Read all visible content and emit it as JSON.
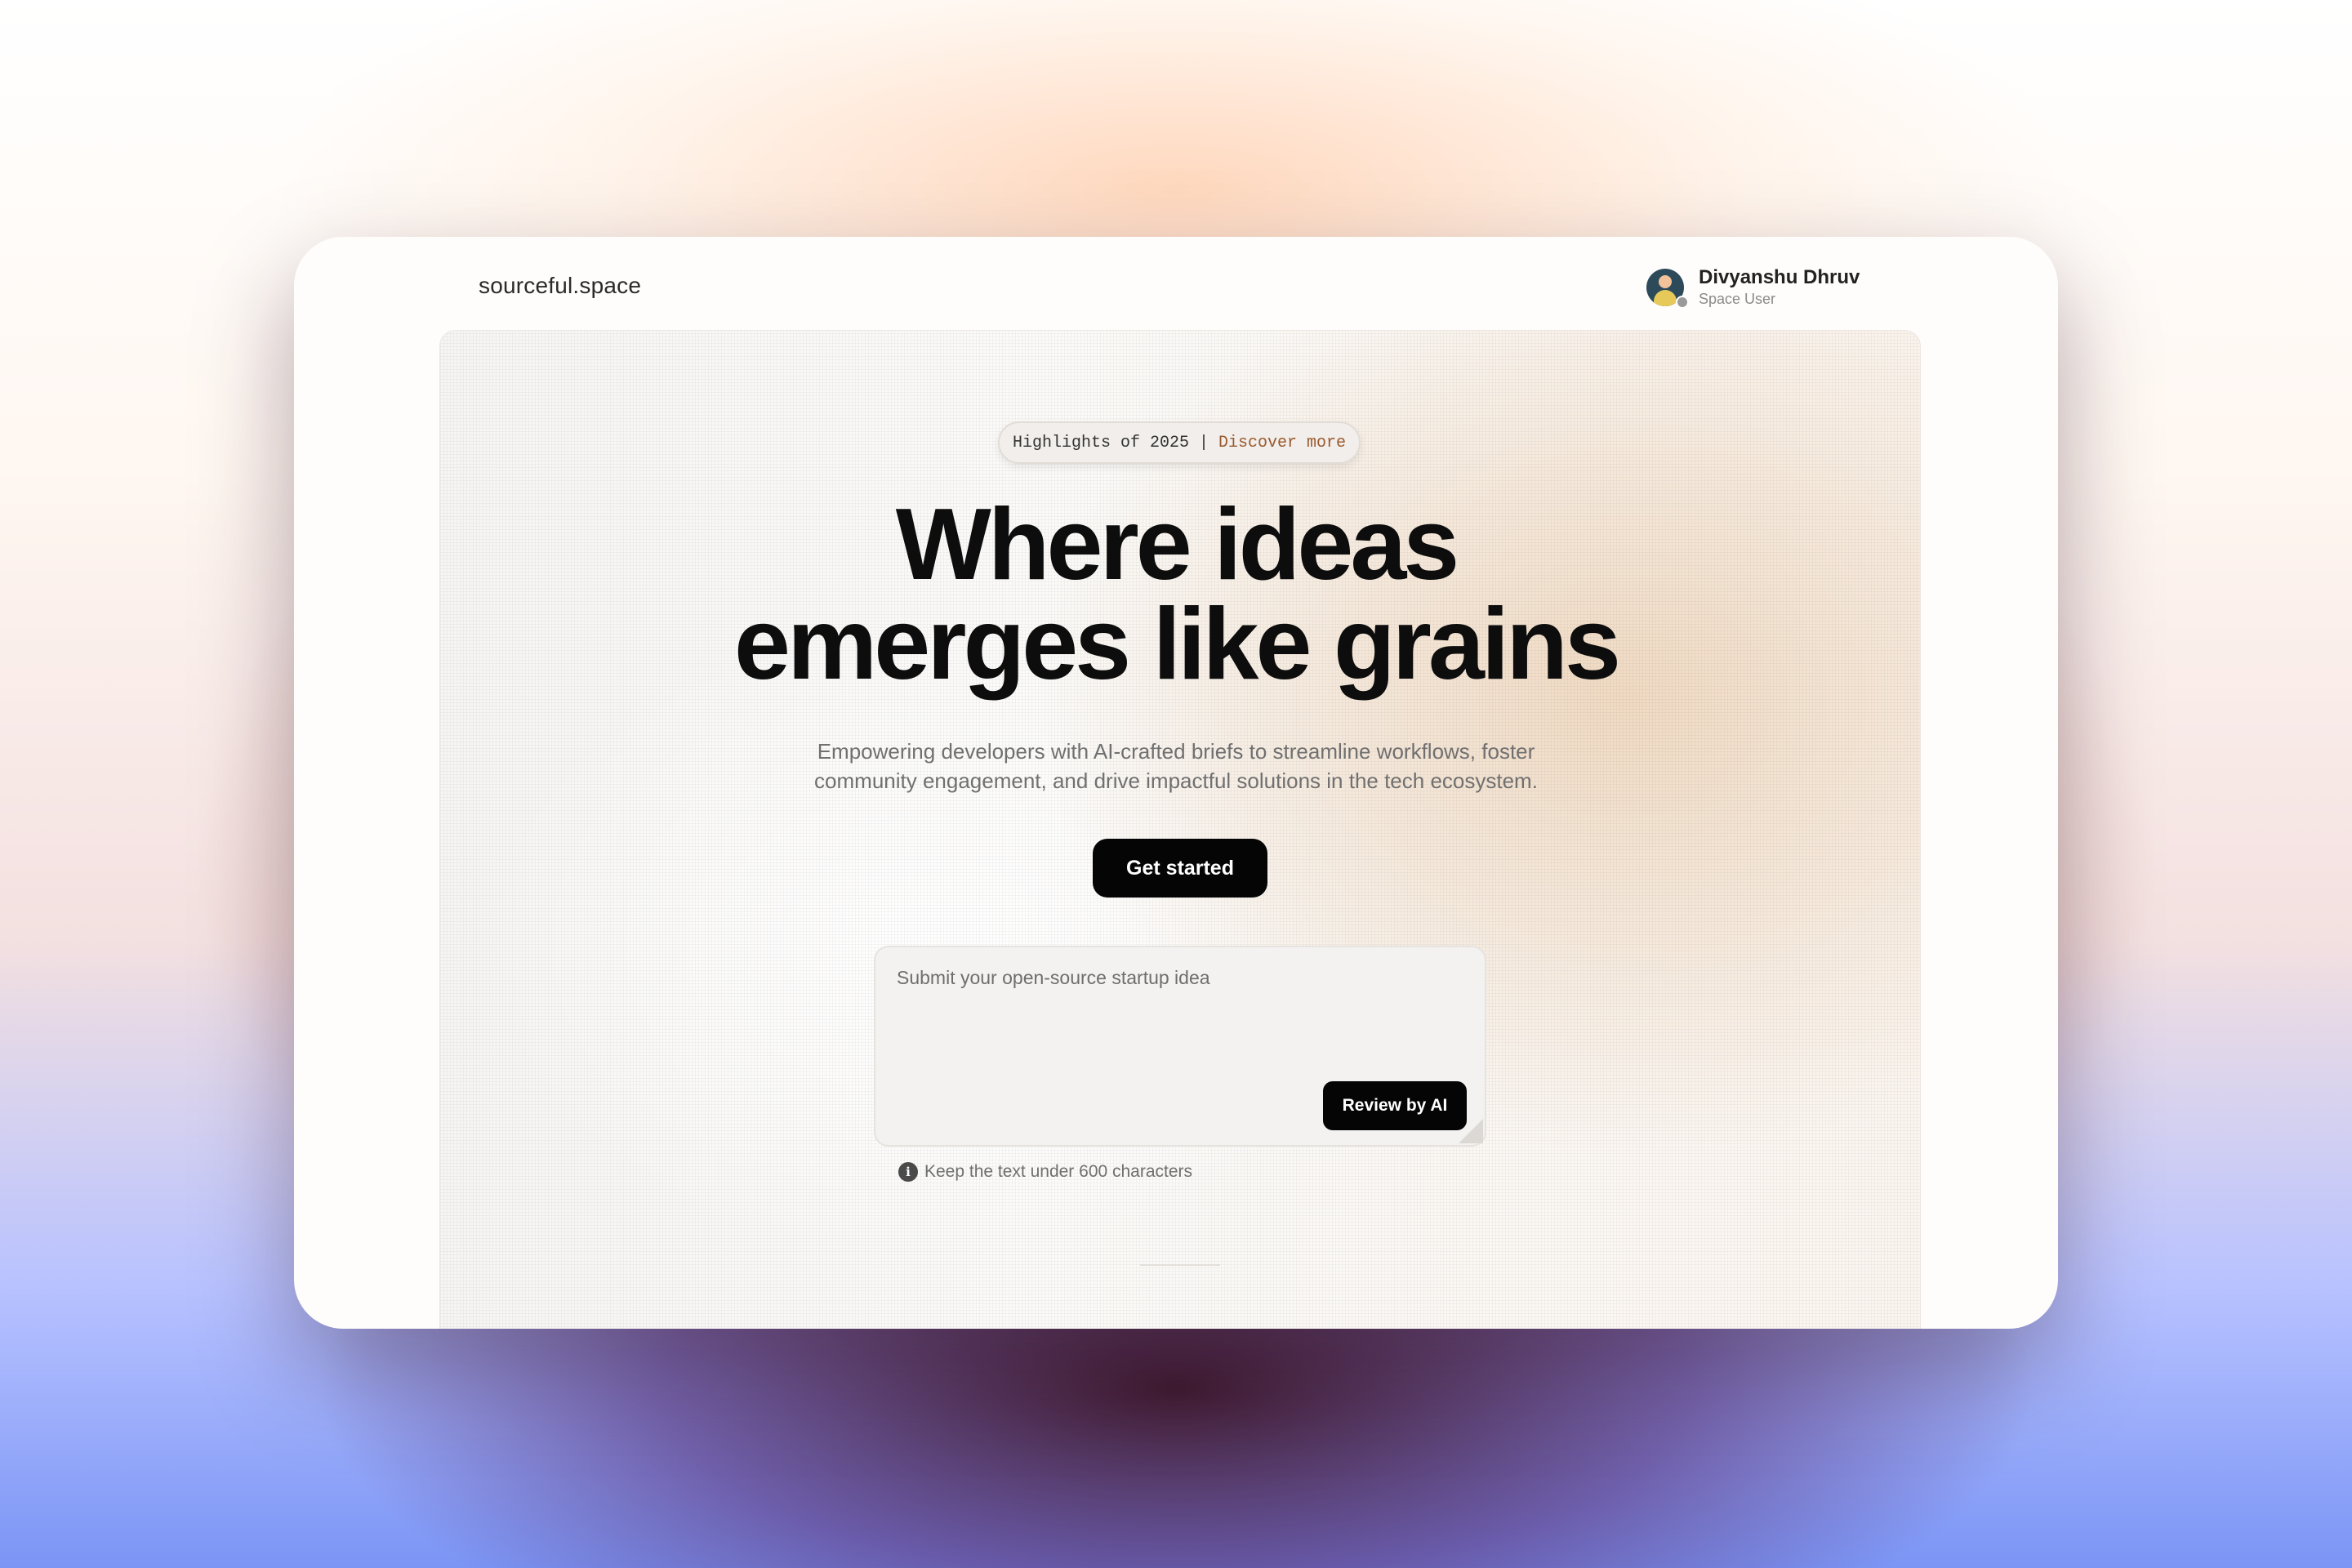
{
  "header": {
    "brand": "sourceful.space",
    "user": {
      "name": "Divyanshu Dhruv",
      "role": "Space User"
    }
  },
  "hero": {
    "pill": {
      "label": "Highlights of 2025",
      "separator": "|",
      "link": "Discover more"
    },
    "headline_line1": "Where ideas",
    "headline_line2": "emerges like grains",
    "subtitle_line1": "Empowering developers with AI-crafted briefs to streamline workflows, foster",
    "subtitle_line2": "community engagement, and drive impactful solutions in the tech ecosystem.",
    "cta_label": "Get started"
  },
  "idea_form": {
    "placeholder": "Submit your open-source startup idea",
    "submit_label": "Review by AI",
    "hint": "Keep the text under 600 characters",
    "hint_icon": "info-icon"
  },
  "colors": {
    "accent_link": "#9a5a2e",
    "button_bg": "#050505",
    "text_primary": "#0d0d0d"
  }
}
